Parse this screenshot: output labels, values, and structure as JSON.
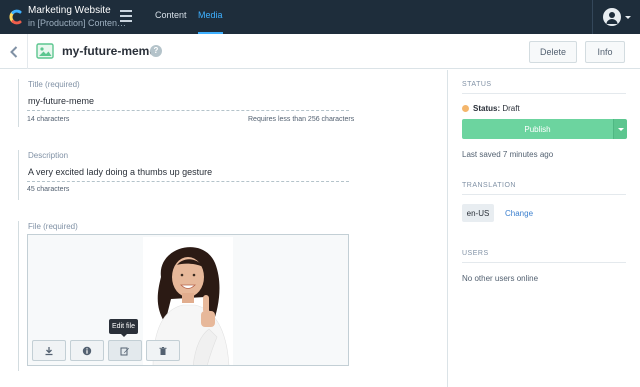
{
  "topbar": {
    "space_name": "Marketing Website",
    "space_env": "in [Production] Conten…",
    "tabs": [
      {
        "label": "Content",
        "active": false
      },
      {
        "label": "Media",
        "active": true
      }
    ]
  },
  "entity": {
    "title": "my-future-meme",
    "delete_label": "Delete",
    "info_label": "Info"
  },
  "fields": {
    "title": {
      "label": "Title (required)",
      "value": "my-future-meme",
      "count": "14 characters",
      "limit": "Requires less than 256 characters"
    },
    "description": {
      "label": "Description",
      "value": "A very excited lady doing a thumbs up gesture",
      "count": "45 characters"
    },
    "file": {
      "label": "File (required)",
      "tooltip": "Edit file"
    }
  },
  "sidebar": {
    "status": {
      "heading": "STATUS",
      "label": "Status:",
      "value": "Draft",
      "publish_label": "Publish",
      "last_saved": "Last saved 7 minutes ago"
    },
    "translation": {
      "heading": "TRANSLATION",
      "locale": "en-US",
      "change_label": "Change"
    },
    "users": {
      "heading": "USERS",
      "empty": "No other users online"
    }
  },
  "colors": {
    "topbar_bg": "#1e2d3b",
    "accent_blue": "#3eb0ff",
    "publish_green": "#6cd49f",
    "status_draft": "#f4b66c",
    "link_blue": "#3c80cf"
  }
}
